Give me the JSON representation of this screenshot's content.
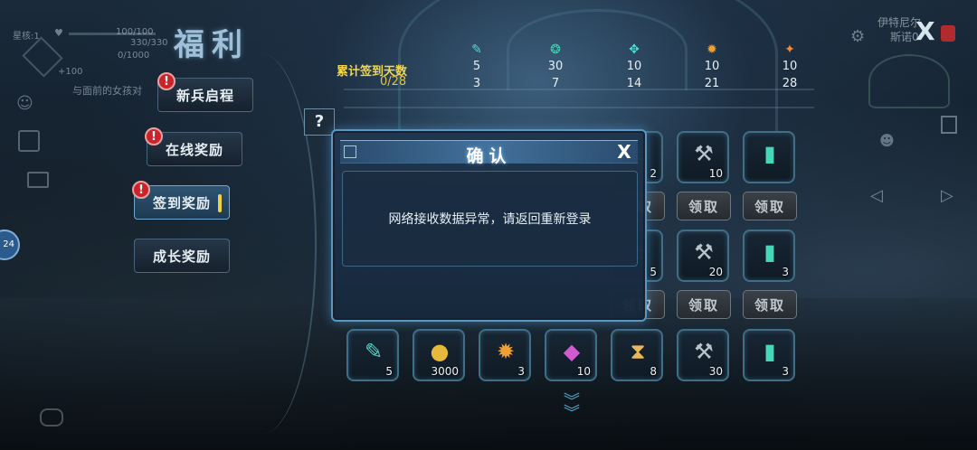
{
  "hud": {
    "level_label": "星核:1",
    "hp_value": "100/100",
    "energy_value": "330/330",
    "exp_value": "0/1000",
    "bonus_value": "+100",
    "quest_text": "与面前的女孩对",
    "side_badge": "24",
    "user_name": "伊特尼尔",
    "user_sub": "斯诺0"
  },
  "page": {
    "title": "福利",
    "help_label": "?",
    "close_label": "X",
    "scroll_down_icon": "double-chevron-down-icon"
  },
  "menu": {
    "items": [
      {
        "label": "新兵启程",
        "alert": "!"
      },
      {
        "label": "在线奖励",
        "alert": "!"
      },
      {
        "label": "签到奖励",
        "alert": "!",
        "active": true
      },
      {
        "label": "成长奖励"
      }
    ]
  },
  "signin": {
    "label": "累计签到天数",
    "progress": "0/28",
    "milestones": [
      {
        "icon": "syringe-icon",
        "count": "5",
        "day": "3"
      },
      {
        "icon": "candy-icon",
        "count": "30",
        "day": "7"
      },
      {
        "icon": "target-icon",
        "count": "10",
        "day": "14"
      },
      {
        "icon": "explosion-icon",
        "count": "10",
        "day": "21"
      },
      {
        "icon": "wrench-icon",
        "count": "10",
        "day": "28"
      }
    ]
  },
  "rewards": {
    "claim_label": "领取",
    "row1": [
      {
        "icon": "ticket-icon",
        "count": "2"
      },
      {
        "icon": "hammer-icon",
        "count": "10"
      },
      {
        "icon": "card-icon",
        "count": ""
      }
    ],
    "row2": [
      {
        "icon": "ticket-icon",
        "count": "5"
      },
      {
        "icon": "hammer-icon",
        "count": "20"
      },
      {
        "icon": "card-icon",
        "count": "3"
      }
    ],
    "row3": [
      {
        "icon": "syringe-icon",
        "count": "5"
      },
      {
        "icon": "coins-icon",
        "count": "3000"
      },
      {
        "icon": "explosion-icon",
        "count": "3"
      },
      {
        "icon": "crystal-icon",
        "count": "10"
      },
      {
        "icon": "hourglass-card-icon",
        "count": "8"
      },
      {
        "icon": "hammer-icon",
        "count": "30"
      },
      {
        "icon": "card-icon",
        "count": "3"
      }
    ]
  },
  "dialog": {
    "title": "确认",
    "message": "网络接收数据异常，请返回重新登录",
    "close_label": "X"
  }
}
